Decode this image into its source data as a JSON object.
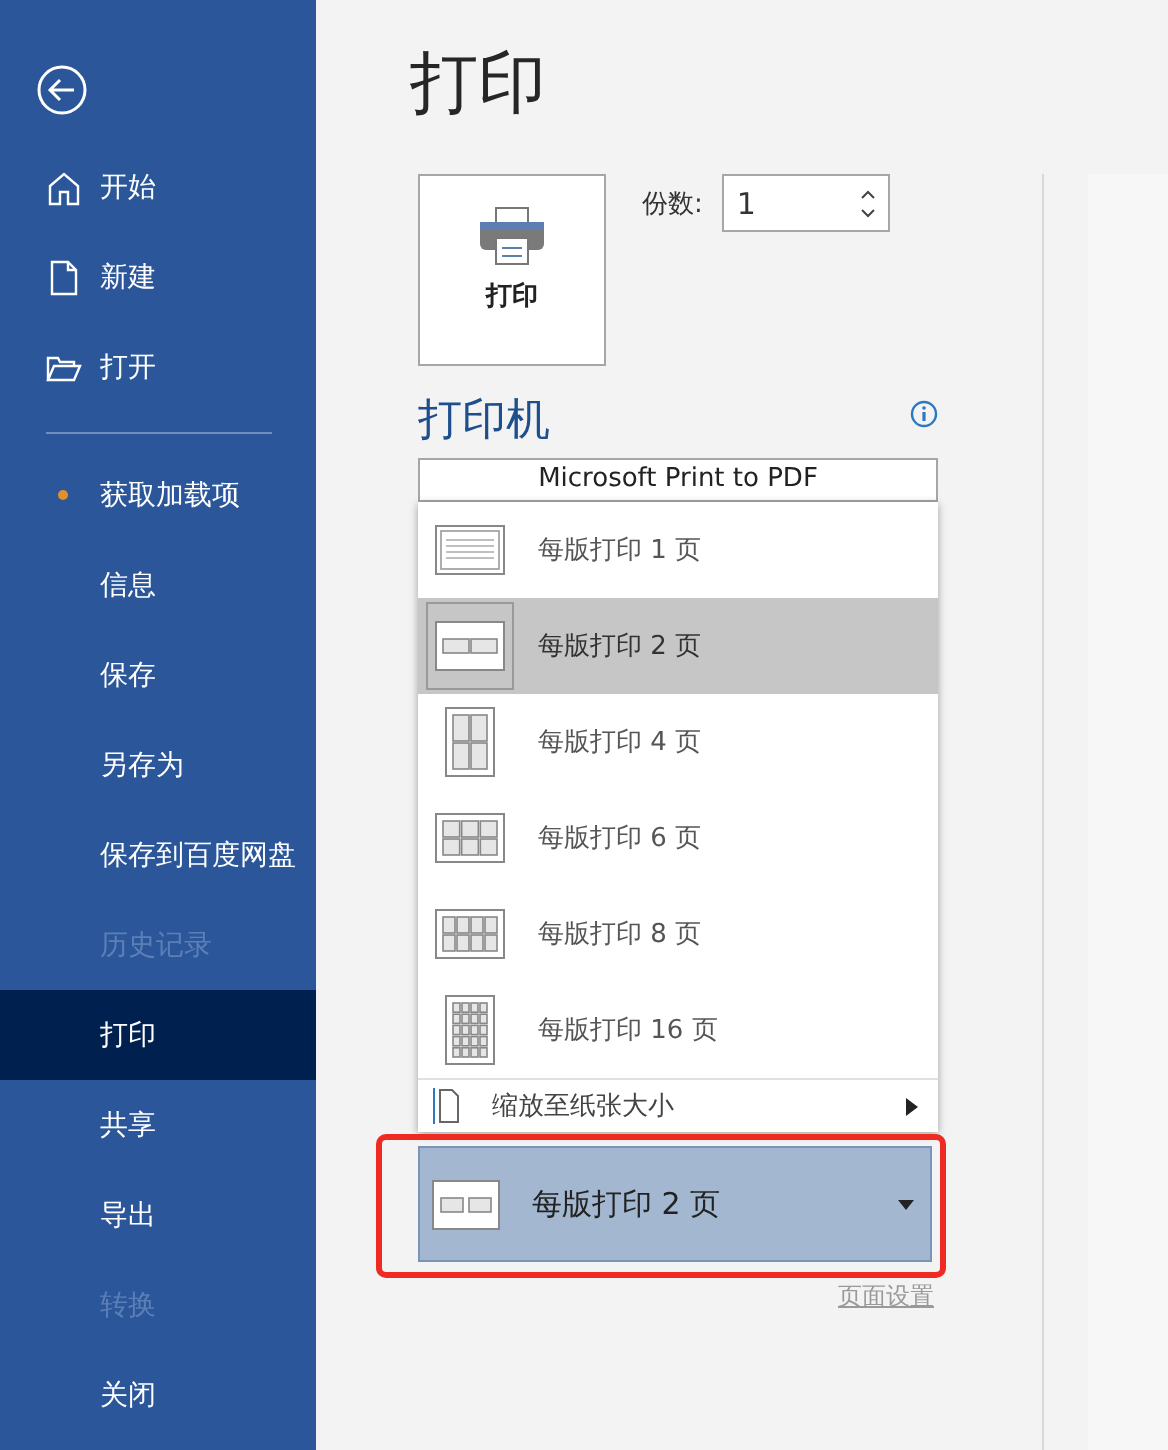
{
  "sidebar": {
    "top_items": [
      {
        "label": "开始",
        "kind": "home"
      },
      {
        "label": "新建",
        "kind": "new"
      },
      {
        "label": "打开",
        "kind": "open"
      }
    ],
    "items": [
      {
        "label": "获取加载项",
        "selected": false,
        "disabled": false,
        "notification": true
      },
      {
        "label": "信息",
        "selected": false,
        "disabled": false,
        "notification": false
      },
      {
        "label": "保存",
        "selected": false,
        "disabled": false,
        "notification": false
      },
      {
        "label": "另存为",
        "selected": false,
        "disabled": false,
        "notification": false
      },
      {
        "label": "保存到百度网盘",
        "selected": false,
        "disabled": false,
        "notification": false
      },
      {
        "label": "历史记录",
        "selected": false,
        "disabled": true,
        "notification": false
      },
      {
        "label": "打印",
        "selected": true,
        "disabled": false,
        "notification": false
      },
      {
        "label": "共享",
        "selected": false,
        "disabled": false,
        "notification": false
      },
      {
        "label": "导出",
        "selected": false,
        "disabled": false,
        "notification": false
      },
      {
        "label": "转换",
        "selected": false,
        "disabled": true,
        "notification": false
      },
      {
        "label": "关闭",
        "selected": false,
        "disabled": false,
        "notification": false
      }
    ]
  },
  "page": {
    "title": "打印"
  },
  "print_button": {
    "label": "打印"
  },
  "copies": {
    "label": "份数:",
    "value": "1"
  },
  "printer": {
    "heading": "打印机",
    "device": "Microsoft Print to PDF"
  },
  "pages_menu": {
    "items": [
      {
        "label": "每版打印 1 页",
        "selected": false
      },
      {
        "label": "每版打印 2 页",
        "selected": true
      },
      {
        "label": "每版打印 4 页",
        "selected": false
      },
      {
        "label": "每版打印 6 页",
        "selected": false
      },
      {
        "label": "每版打印 8 页",
        "selected": false
      },
      {
        "label": "每版打印 16 页",
        "selected": false
      }
    ],
    "scale_item": {
      "label": "缩放至纸张大小"
    }
  },
  "pages_per_sheet": {
    "value": "每版打印 2 页",
    "highlighted": true
  },
  "page_setup_link": {
    "label": "页面设置"
  }
}
